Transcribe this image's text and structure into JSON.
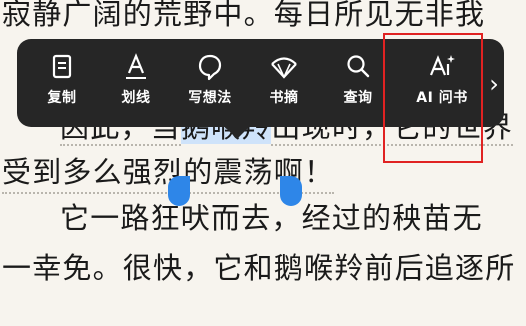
{
  "reader": {
    "line1": "寂静广阔的荒野中。每日所见无非我",
    "line2_pre": "因此，当",
    "line2_sel": "鹅喉羚",
    "line2_post": "出现时，它的世界",
    "line3": "受到多么强烈的震荡啊！",
    "line4": "它一路狂吠而去，经过的秧苗无",
    "line5": "一幸免。很快，它和鹅喉羚前后追逐所"
  },
  "toolbar": {
    "copy": "复制",
    "underline": "划线",
    "note": "写想法",
    "excerpt": "书摘",
    "search": "查询",
    "ai_ask": "AI 问书",
    "more": "›"
  },
  "colors": {
    "toolbar_bg": "#262626",
    "selection": "#cfe3fa",
    "handle": "#2e86e8",
    "annotation": "#e02222"
  }
}
